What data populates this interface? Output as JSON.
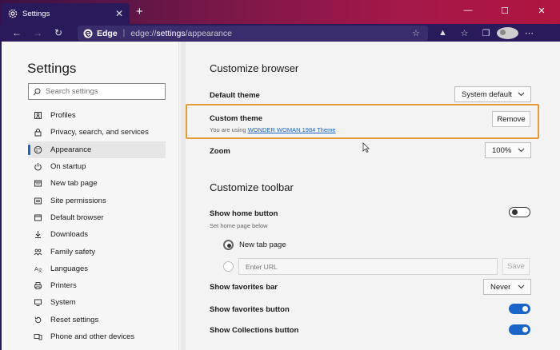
{
  "window": {
    "tab_title": "Settings",
    "tab_close": "✕",
    "new_tab": "+",
    "controls": [
      "—",
      "☐",
      "✕"
    ]
  },
  "toolbar": {
    "back": "←",
    "forward": "→",
    "refresh": "↻",
    "brand": "Edge",
    "separator": "|",
    "url_prefix": "edge://",
    "url_path": "settings",
    "url_suffix": "/appearance"
  },
  "sidebar": {
    "title": "Settings",
    "search_placeholder": "Search settings",
    "items": [
      {
        "label": "Profiles",
        "icon": "profile-icon",
        "active": false
      },
      {
        "label": "Privacy, search, and services",
        "icon": "lock-icon",
        "active": false
      },
      {
        "label": "Appearance",
        "icon": "palette-icon",
        "active": true
      },
      {
        "label": "On startup",
        "icon": "power-icon",
        "active": false
      },
      {
        "label": "New tab page",
        "icon": "newtab-icon",
        "active": false
      },
      {
        "label": "Site permissions",
        "icon": "permissions-icon",
        "active": false
      },
      {
        "label": "Default browser",
        "icon": "browser-icon",
        "active": false
      },
      {
        "label": "Downloads",
        "icon": "download-icon",
        "active": false
      },
      {
        "label": "Family safety",
        "icon": "family-icon",
        "active": false
      },
      {
        "label": "Languages",
        "icon": "language-icon",
        "active": false
      },
      {
        "label": "Printers",
        "icon": "printer-icon",
        "active": false
      },
      {
        "label": "System",
        "icon": "system-icon",
        "active": false
      },
      {
        "label": "Reset settings",
        "icon": "reset-icon",
        "active": false
      },
      {
        "label": "Phone and other devices",
        "icon": "phone-icon",
        "active": false
      }
    ]
  },
  "main": {
    "customize_browser": {
      "title": "Customize browser",
      "default_theme_label": "Default theme",
      "default_theme_value": "System default",
      "custom_theme_label": "Custom theme",
      "custom_theme_prefix": "You are using",
      "custom_theme_link": "WONDER WOMAN 1984 Theme",
      "remove_button": "Remove",
      "zoom_label": "Zoom",
      "zoom_value": "100%"
    },
    "customize_toolbar": {
      "title": "Customize toolbar",
      "home_button_label": "Show home button",
      "home_button_sub": "Set home page below",
      "home_button_on": false,
      "radio_newtab_label": "New tab page",
      "url_placeholder": "Enter URL",
      "save_button": "Save",
      "favorites_bar_label": "Show favorites bar",
      "favorites_bar_value": "Never",
      "favorites_button_label": "Show favorites button",
      "favorites_button_on": true,
      "collections_button_label": "Show Collections button",
      "collections_button_on": true
    }
  },
  "colors": {
    "accent": "#1a63c7",
    "highlight_border": "#e59a3a",
    "toolbar_bg": "#2a1a5c"
  }
}
